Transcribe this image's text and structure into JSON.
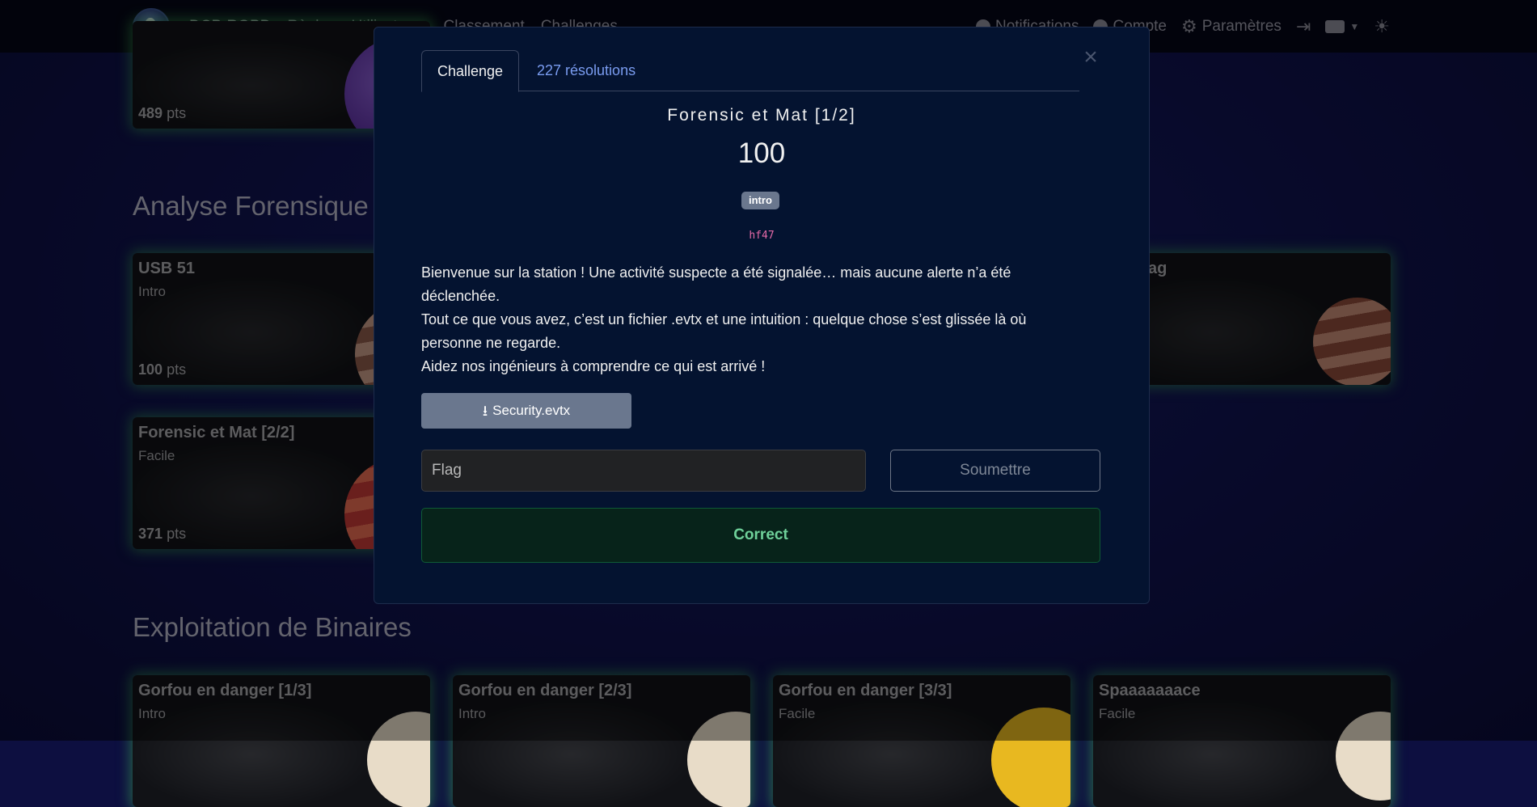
{
  "navbar": {
    "brand": "DCP-RGPD",
    "links": [
      "Règles",
      "Utilisateurs",
      "Classement",
      "Challenges"
    ],
    "right": {
      "notifications": "Notifications",
      "account": "Compte",
      "settings": "Paramètres"
    }
  },
  "background": {
    "top_card_points": "489",
    "pts_label": "pts",
    "sections": [
      "Analyse Forensique",
      "Exploitation de Binaires"
    ],
    "forensic_cards": [
      {
        "title": "USB 51",
        "difficulty": "Intro",
        "points": "100"
      },
      {
        "title": "Forensic et Mat [2/2]",
        "difficulty": "Facile",
        "points": "371"
      },
      {
        "title": "rflag",
        "difficulty": "",
        "points": ""
      }
    ],
    "binary_cards": [
      {
        "title": "Gorfou en danger [1/3]",
        "difficulty": "Intro"
      },
      {
        "title": "Gorfou en danger [2/3]",
        "difficulty": "Intro"
      },
      {
        "title": "Gorfou en danger [3/3]",
        "difficulty": "Facile"
      },
      {
        "title": "Spaaaaaaace",
        "difficulty": "Facile"
      }
    ]
  },
  "modal": {
    "close": "×",
    "tabs": {
      "challenge": "Challenge",
      "solves": "227 résolutions"
    },
    "name": "Forensic et Mat [1/2]",
    "value": "100",
    "tag": "intro",
    "author": "hf47",
    "description": [
      "Bienvenue sur la station ! Une activité suspecte a été signalée… mais aucune alerte n’a été déclenchée.",
      "Tout ce que vous avez, c’est un fichier .evtx et une intuition : quelque chose s’est glissée là où personne ne regarde.",
      "Aidez nos ingénieurs à comprendre ce qui est arrivé !"
    ],
    "file_button": "Security.evtx",
    "flag_placeholder": "Flag",
    "submit": "Soumettre",
    "result": "Correct"
  }
}
